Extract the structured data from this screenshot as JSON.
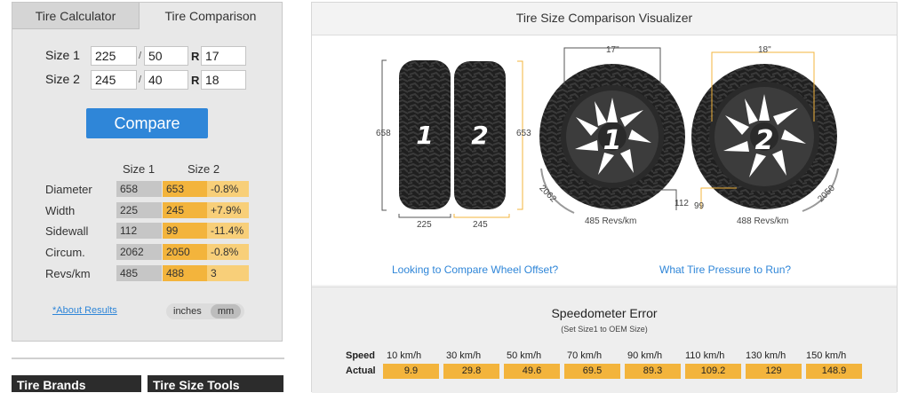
{
  "tabs": {
    "calculator": "Tire Calculator",
    "comparison": "Tire Comparison"
  },
  "sizes": [
    {
      "label": "Size 1",
      "width": "225",
      "aspect": "50",
      "sep": "/",
      "r": "R",
      "rim": "17"
    },
    {
      "label": "Size 2",
      "width": "245",
      "aspect": "40",
      "sep": "/",
      "r": "R",
      "rim": "18"
    }
  ],
  "compare_label": "Compare",
  "results": {
    "col1": "Size 1",
    "col2": "Size 2",
    "rows": [
      {
        "label": "Diameter",
        "v1": "658",
        "v2": "653",
        "diff": "-0.8%"
      },
      {
        "label": "Width",
        "v1": "225",
        "v2": "245",
        "diff": "+7.9%"
      },
      {
        "label": "Sidewall",
        "v1": "112",
        "v2": "99",
        "diff": "-11.4%"
      },
      {
        "label": "Circum.",
        "v1": "2062",
        "v2": "2050",
        "diff": "-0.8%"
      },
      {
        "label": "Revs/km",
        "v1": "485",
        "v2": "488",
        "diff": "3"
      }
    ]
  },
  "about_link": "*About Results",
  "units": {
    "inches": "inches",
    "mm": "mm",
    "selected": "mm"
  },
  "footer_boxes": [
    "Tire Brands",
    "Tire Size Tools"
  ],
  "visualizer": {
    "title": "Tire Size Comparison Visualizer",
    "tire1": {
      "number": "1",
      "diameter": "658",
      "width": "225",
      "rim": "17\"",
      "sidewall": "112",
      "circum": "2062",
      "revs": "485 Revs/km"
    },
    "tire2": {
      "number": "2",
      "diameter": "653",
      "width": "245",
      "rim": "18\"",
      "sidewall": "99",
      "circum": "2050",
      "revs": "488 Revs/km"
    },
    "link_offset": "Looking to Compare Wheel Offset?",
    "link_pressure": "What Tire Pressure to Run?"
  },
  "speedometer": {
    "title": "Speedometer Error",
    "subtitle": "(Set Size1 to OEM Size)",
    "speed_label": "Speed",
    "actual_label": "Actual",
    "speeds": [
      "10 km/h",
      "30 km/h",
      "50 km/h",
      "70 km/h",
      "90 km/h",
      "110 km/h",
      "130 km/h",
      "150 km/h"
    ],
    "actuals": [
      "9.9",
      "29.8",
      "49.6",
      "69.5",
      "89.3",
      "109.2",
      "129",
      "148.9"
    ]
  },
  "colors": {
    "accent": "#2f86d8",
    "highlight": "#f3b43c",
    "highlight_light": "#f8cf79",
    "grey_cell": "#c6c6c6",
    "dark": "#2c2c2c"
  }
}
